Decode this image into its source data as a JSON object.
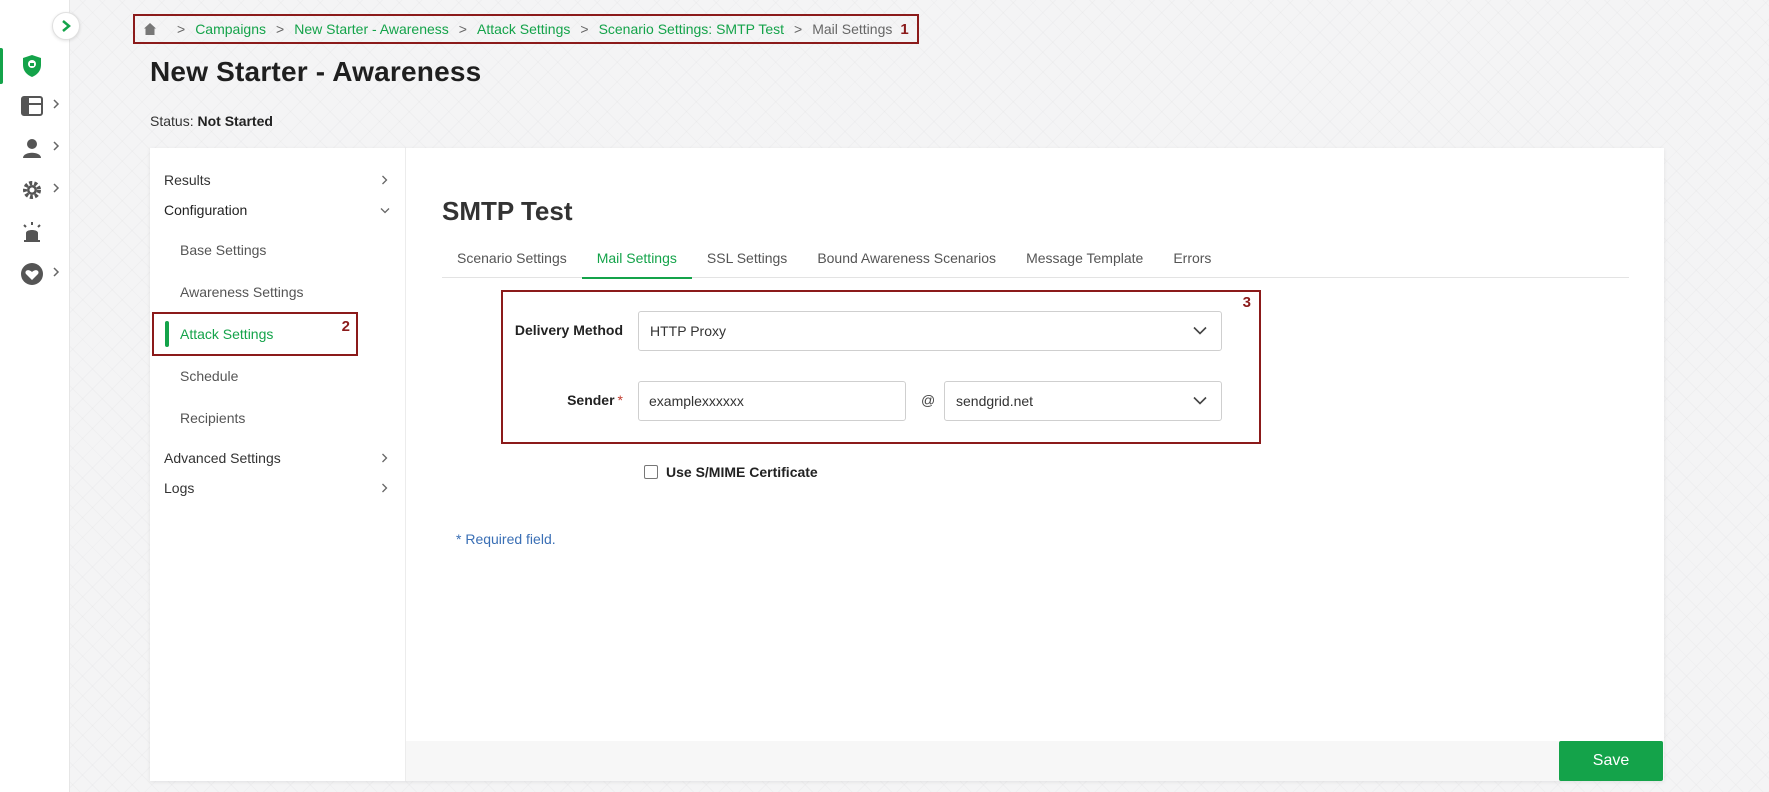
{
  "breadcrumb": {
    "home_icon": "home-icon",
    "separator": ">",
    "items": [
      "Campaigns",
      "New Starter - Awareness",
      "Attack Settings",
      "Scenario Settings: SMTP Test"
    ],
    "current": "Mail Settings",
    "annotation": "1"
  },
  "page": {
    "title": "New Starter - Awareness",
    "status_label": "Status:",
    "status_value": "Not Started"
  },
  "rail": {
    "icons": [
      "chevron-right-icon",
      "shield-logo-icon",
      "dashboard-icon",
      "users-icon",
      "gear-icon",
      "alarm-icon",
      "heart-icon"
    ],
    "accent": "#14a34a"
  },
  "side_nav": {
    "results": "Results",
    "configuration": "Configuration",
    "sub_items": [
      "Base Settings",
      "Awareness Settings",
      "Attack Settings",
      "Schedule",
      "Recipients"
    ],
    "active_annotation": "2",
    "advanced": "Advanced Settings",
    "logs": "Logs"
  },
  "content": {
    "section_title": "SMTP Test",
    "tabs": [
      "Scenario Settings",
      "Mail Settings",
      "SSL Settings",
      "Bound Awareness Scenarios",
      "Message Template",
      "Errors"
    ],
    "active_tab": "Mail Settings",
    "form_annotation": "3",
    "delivery_label": "Delivery Method",
    "delivery_value": "HTTP Proxy",
    "sender_label": "Sender",
    "required_star": "*",
    "sender_local": "examplexxxxxx",
    "at": "@",
    "sender_domain": "sendgrid.net",
    "smime_label": "Use S/MIME Certificate",
    "required_note": "* Required field."
  },
  "actions": {
    "save": "Save"
  },
  "colors": {
    "brand_green": "#14a34a",
    "annotation_red": "#8b1a1a",
    "link_blue": "#3a6fb5"
  }
}
